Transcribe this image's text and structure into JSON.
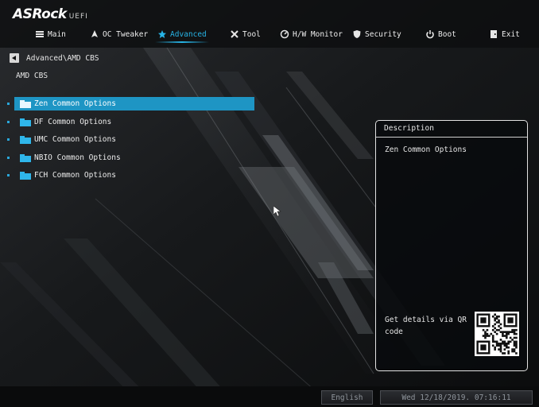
{
  "brand": {
    "name": "ASRock",
    "suffix": "UEFI"
  },
  "nav": {
    "items": [
      {
        "label": "Main",
        "icon": "list-icon"
      },
      {
        "label": "OC Tweaker",
        "icon": "rocket-icon"
      },
      {
        "label": "Advanced",
        "icon": "star-icon",
        "active": true
      },
      {
        "label": "Tool",
        "icon": "wrench-icon"
      },
      {
        "label": "H/W Monitor",
        "icon": "monitor-gauge-icon"
      },
      {
        "label": "Security",
        "icon": "shield-icon"
      },
      {
        "label": "Boot",
        "icon": "power-icon"
      },
      {
        "label": "Exit",
        "icon": "door-icon"
      }
    ]
  },
  "breadcrumb": {
    "path": "Advanced\\AMD CBS"
  },
  "page": {
    "title": "AMD CBS"
  },
  "menu": {
    "items": [
      {
        "label": "Zen Common Options",
        "selected": true
      },
      {
        "label": "DF Common Options"
      },
      {
        "label": "UMC Common Options"
      },
      {
        "label": "NBIO Common Options"
      },
      {
        "label": "FCH Common Options"
      }
    ]
  },
  "description": {
    "title": "Description",
    "text": "Zen Common Options",
    "qr_text": "Get details via QR code"
  },
  "footer": {
    "language": "English",
    "datetime": "Wed 12/18/2019. 07:16:11"
  },
  "colors": {
    "accent": "#1e95c4",
    "folder": "#2fb6ea",
    "active_tab": "#27b4e6"
  }
}
